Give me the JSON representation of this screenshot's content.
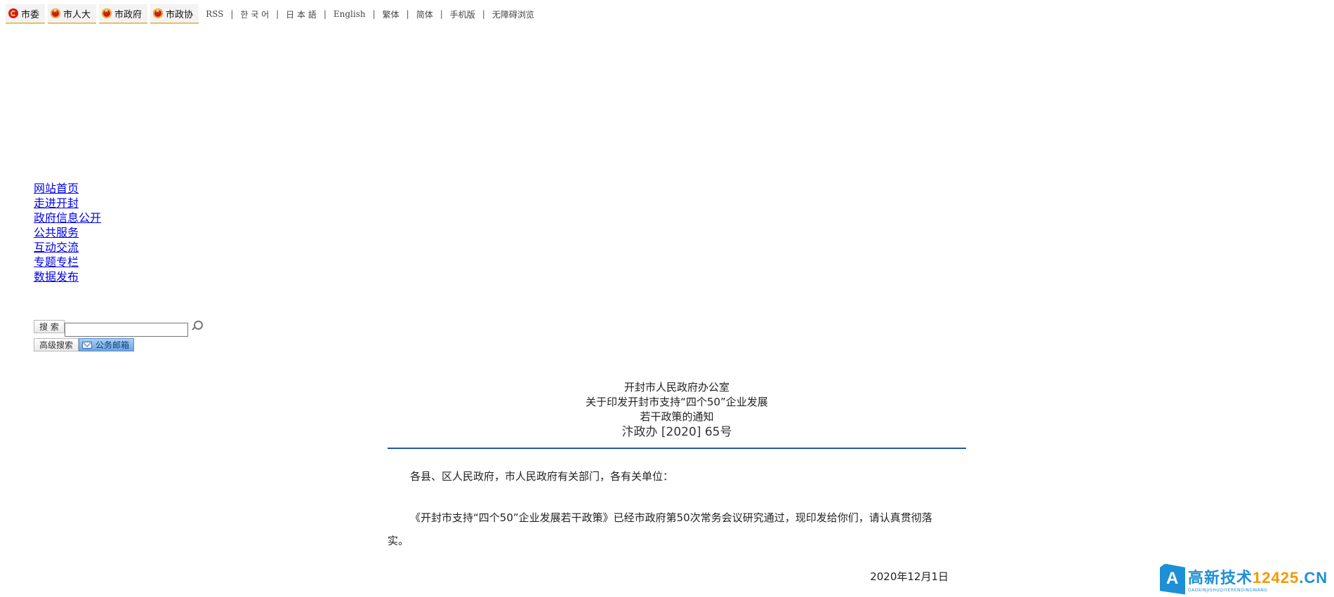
{
  "topbar": {
    "tabs": [
      {
        "label": "市委",
        "icon": "party-emblem-icon"
      },
      {
        "label": "市人大",
        "icon": "state-emblem-icon"
      },
      {
        "label": "市政府",
        "icon": "state-emblem-icon"
      },
      {
        "label": "市政协",
        "icon": "cppcc-emblem-icon"
      }
    ],
    "links": [
      "RSS",
      "한 국 어",
      "日 本 語",
      "English",
      "繁体",
      "简体",
      "手机版",
      "无障碍浏览"
    ]
  },
  "nav": {
    "items": [
      "网站首页",
      "走进开封",
      "政府信息公开",
      "公共服务",
      "互动交流",
      "专题专栏",
      "数据发布"
    ]
  },
  "search": {
    "search_button": "搜 索",
    "input_value": "",
    "advanced_button": "高级搜索",
    "mail_button": "公务邮箱"
  },
  "article": {
    "issuer": "开封市人民政府办公室",
    "title_line1": "关于印发开封市支持“四个50”企业发展",
    "title_line2": "若干政策的通知",
    "doc_number": "汴政办 [2020] 65号",
    "addressee": "各县、区人民政府，市人民政府有关部门，各有关单位：",
    "body": "《开封市支持“四个50”企业发展若干政策》已经市政府第50次常务会议研究通过，现印发给你们，请认真贯彻落实。",
    "date": "2020年12月1日"
  },
  "watermark": {
    "logo_letter": "A",
    "text_main": "高新技术",
    "text_num": "12425",
    "text_tld": ".CN",
    "text_sub": "GAOXINJISHUQIYERENDINGWANG"
  },
  "colors": {
    "rule": "#1e5aa8",
    "link": "#0000ee",
    "brand": "#1d8fd6"
  }
}
